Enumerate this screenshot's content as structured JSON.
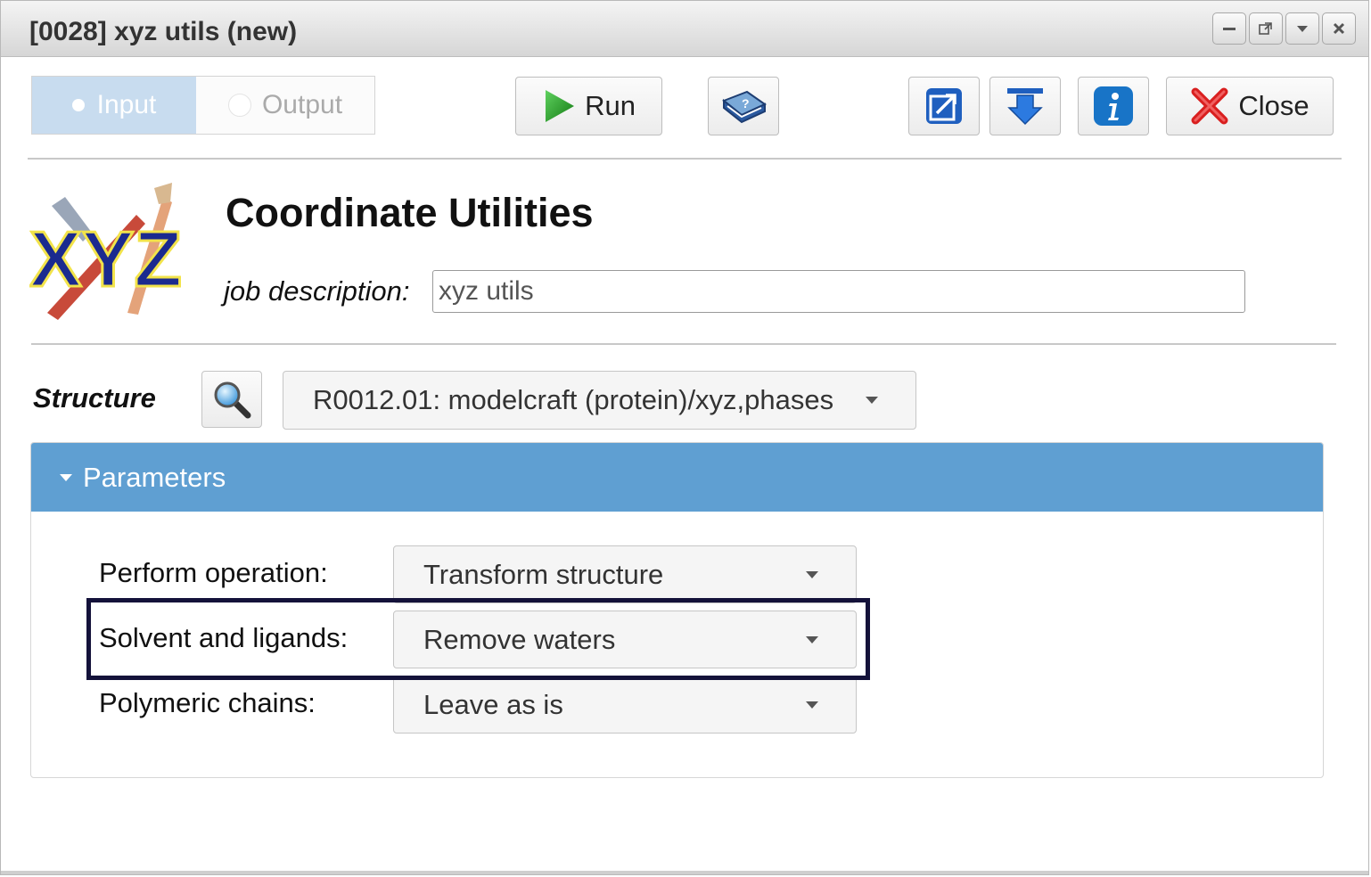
{
  "window": {
    "title": "[0028] xyz utils (new)"
  },
  "toolbar": {
    "tab_input": "Input",
    "tab_output": "Output",
    "run_label": "Run",
    "close_label": "Close"
  },
  "header": {
    "logo_text": "XYZ",
    "app_title": "Coordinate Utilities",
    "job_description_label": "job description:",
    "job_description_value": "xyz utils"
  },
  "structure": {
    "label": "Structure",
    "selected": "R0012.01: modelcraft (protein)/xyz,phases"
  },
  "parameters": {
    "title": "Parameters",
    "rows": [
      {
        "label": "Perform operation:",
        "value": "Transform structure"
      },
      {
        "label": "Solvent and ligands:",
        "value": "Remove waters"
      },
      {
        "label": "Polymeric chains:",
        "value": "Leave as is"
      }
    ]
  },
  "colors": {
    "panel_header": "#5f9fd2",
    "input_tab_active": "#c8dcef",
    "highlight_border": "#14123a"
  }
}
